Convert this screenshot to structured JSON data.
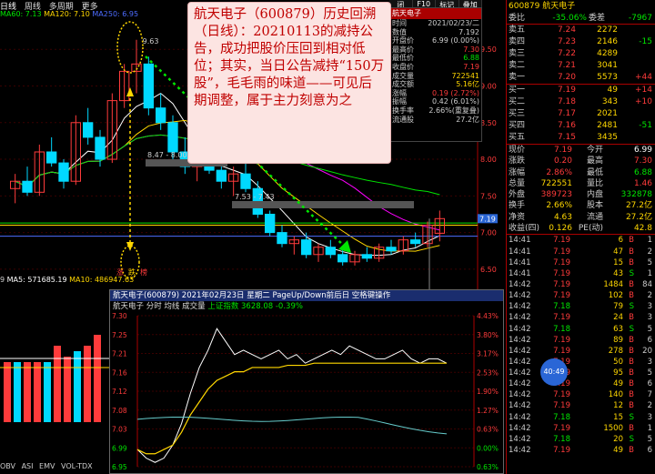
{
  "tabs": [
    "日线",
    "周线",
    "多周期",
    "更多"
  ],
  "ma_top": [
    {
      "label": "MA60: 7.13",
      "color": "#00e600"
    },
    {
      "label": "MA120: 7.10",
      "color": "#ffd700"
    },
    {
      "label": "MA250: 6.95",
      "color": "#4d6cff"
    }
  ],
  "annotation": "航天电子（600879）历史回溯（日线）：20210113的减持公告，成功把股价压回到相对低位；其实，当日公告减持“150万股”，毛毛雨的味道——可见后期调整，属于主力刻意为之",
  "fkeys": [
    "闭",
    "F10",
    "标记",
    "叠加"
  ],
  "info_window": {
    "title": "航天电子",
    "rows": [
      {
        "k": "时间",
        "v": "2021/02/23/二",
        "c": "#ccc"
      },
      {
        "k": "数值",
        "v": "7.192",
        "c": "#ccc"
      },
      {
        "k": "开盘价",
        "v": "6.99 (0.00%)",
        "c": "#ccc"
      },
      {
        "k": "最高价",
        "v": "7.30",
        "c": "#ff3b3b"
      },
      {
        "k": "最低价",
        "v": "6.88",
        "c": "#00e600"
      },
      {
        "k": "收盘价",
        "v": "7.19",
        "c": "#ff3b3b"
      },
      {
        "k": "成交量",
        "v": "722541",
        "c": "#ffd700"
      },
      {
        "k": "成交额",
        "v": "5.16亿",
        "c": "#ffd700"
      },
      {
        "k": "涨幅",
        "v": "0.19 (2.72%)",
        "c": "#ff3b3b"
      },
      {
        "k": "振幅",
        "v": "0.42 (6.01%)",
        "c": "#ccc"
      },
      {
        "k": "换手率",
        "v": "2.66%(重复叠)",
        "c": "#ccc"
      },
      {
        "k": "流通股",
        "v": "27.2亿",
        "c": "#ccc"
      }
    ]
  },
  "chart_labels": {
    "peak": "9.63",
    "box1": "8.47 - 8.00",
    "box2": "7.53 - 7.43",
    "price_marker": "7.19",
    "dots_text": [
      "涨",
      "跌",
      "榜"
    ]
  },
  "chart_data": {
    "type": "candlestick",
    "y_ticks": [
      "9.50",
      "9.00",
      "8.50",
      "8.00",
      "7.50",
      "7.00",
      "6.50"
    ],
    "ylim": [
      6.3,
      9.9
    ],
    "candles": [
      [
        7.6,
        7.8,
        7.4,
        7.7
      ],
      [
        7.7,
        7.9,
        7.5,
        7.55
      ],
      [
        7.55,
        8.2,
        7.5,
        8.1
      ],
      [
        8.1,
        8.3,
        7.9,
        7.95
      ],
      [
        7.95,
        8.0,
        7.6,
        7.7
      ],
      [
        7.7,
        8.6,
        7.65,
        8.5
      ],
      [
        8.5,
        8.7,
        8.2,
        8.3
      ],
      [
        8.3,
        8.4,
        7.9,
        8.0
      ],
      [
        8.0,
        8.9,
        7.95,
        8.8
      ],
      [
        8.8,
        9.3,
        8.7,
        9.2
      ],
      [
        9.2,
        9.63,
        8.9,
        9.3
      ],
      [
        9.3,
        9.4,
        8.6,
        8.7
      ],
      [
        8.7,
        8.9,
        8.4,
        8.5
      ],
      [
        8.5,
        8.6,
        8.0,
        8.1
      ],
      [
        8.1,
        8.3,
        7.8,
        7.9
      ],
      [
        7.9,
        8.1,
        7.7,
        8.0
      ],
      [
        8.0,
        8.2,
        7.8,
        7.85
      ],
      [
        7.85,
        8.0,
        7.6,
        7.7
      ],
      [
        7.7,
        7.9,
        7.5,
        7.8
      ],
      [
        7.8,
        7.95,
        7.55,
        7.6
      ],
      [
        7.6,
        7.7,
        7.2,
        7.25
      ],
      [
        7.25,
        7.3,
        6.95,
        7.0
      ],
      [
        7.0,
        7.1,
        6.8,
        6.85
      ],
      [
        6.85,
        6.95,
        6.7,
        6.9
      ],
      [
        6.9,
        7.0,
        6.65,
        6.7
      ],
      [
        6.7,
        6.85,
        6.6,
        6.8
      ],
      [
        6.8,
        6.9,
        6.65,
        6.7
      ],
      [
        6.7,
        6.8,
        6.55,
        6.6
      ],
      [
        6.6,
        6.75,
        6.55,
        6.7
      ],
      [
        6.7,
        6.8,
        6.6,
        6.65
      ],
      [
        6.65,
        6.85,
        6.6,
        6.8
      ],
      [
        6.8,
        6.9,
        6.7,
        6.75
      ],
      [
        6.75,
        6.95,
        6.7,
        6.9
      ],
      [
        6.9,
        7.0,
        6.8,
        6.85
      ],
      [
        6.85,
        7.15,
        6.8,
        7.1
      ],
      [
        6.99,
        7.3,
        6.88,
        7.19
      ]
    ]
  },
  "vol_ma": [
    {
      "label": "MA5: 571685.19",
      "color": "#fff"
    },
    {
      "label": "MA10: 486947.63",
      "color": "#ffd700"
    }
  ],
  "vol_data": [
    0.55,
    0.55,
    0.55,
    0.55,
    0.55,
    0.7,
    0.6,
    0.65,
    0.7,
    0.8
  ],
  "bottom_tabs": [
    "OBV",
    "ASI",
    "EMV",
    "VOL-TDX"
  ],
  "popup": {
    "title": "航天电子(600879) 2021年02月23日 星期二 PageUp/Down前后日 空格键操作",
    "sub": "航天电子  分时  均线  成交量",
    "index": "上证指数 3628.08 -0.39%",
    "y_left": [
      "7.30",
      "7.25",
      "7.21",
      "7.16",
      "7.12",
      "7.08",
      "7.03",
      "6.99",
      "6.95"
    ],
    "y_right": [
      "4.43%",
      "3.80%",
      "3.17%",
      "2.53%",
      "1.90%",
      "1.27%",
      "0.63%",
      "0.00%",
      "0.63%"
    ],
    "price_line": [
      6.99,
      6.97,
      6.96,
      6.97,
      7.0,
      7.05,
      7.12,
      7.18,
      7.22,
      7.27,
      7.24,
      7.21,
      7.22,
      7.21,
      7.2,
      7.21,
      7.22,
      7.2,
      7.21,
      7.19,
      7.2,
      7.21,
      7.22,
      7.21,
      7.23,
      7.22,
      7.21,
      7.2,
      7.2,
      7.21,
      7.22,
      7.2,
      7.19,
      7.2,
      7.2,
      7.19
    ],
    "avg_line": [
      6.99,
      6.98,
      6.98,
      6.99,
      7.0,
      7.03,
      7.07,
      7.1,
      7.13,
      7.15,
      7.16,
      7.17,
      7.17,
      7.18,
      7.18,
      7.18,
      7.18,
      7.185,
      7.185,
      7.185,
      7.19,
      7.19,
      7.19,
      7.19,
      7.19,
      7.19,
      7.19,
      7.19,
      7.19,
      7.19,
      7.19,
      7.19,
      7.19,
      7.19,
      7.19,
      7.19
    ]
  },
  "right": {
    "title": "600879 航天电子",
    "weibi": {
      "k": "委比",
      "v": "-35.06%",
      "k2": "委差",
      "v2": "-7967"
    },
    "asks": [
      {
        "k": "卖五",
        "p": "7.24",
        "v": "2272",
        "c": ""
      },
      {
        "k": "卖四",
        "p": "7.23",
        "v": "2146",
        "c": "-15"
      },
      {
        "k": "卖三",
        "p": "7.22",
        "v": "4289",
        "c": ""
      },
      {
        "k": "卖二",
        "p": "7.21",
        "v": "3041",
        "c": ""
      },
      {
        "k": "卖一",
        "p": "7.20",
        "v": "5573",
        "c": "+44"
      }
    ],
    "bids": [
      {
        "k": "买一",
        "p": "7.19",
        "v": "49",
        "c": "+14"
      },
      {
        "k": "买二",
        "p": "7.18",
        "v": "343",
        "c": "+10"
      },
      {
        "k": "买三",
        "p": "7.17",
        "v": "2021",
        "c": ""
      },
      {
        "k": "买四",
        "p": "7.16",
        "v": "2481",
        "c": "-51"
      },
      {
        "k": "买五",
        "p": "7.15",
        "v": "3435",
        "c": ""
      }
    ],
    "stats": [
      {
        "k": "现价",
        "v": "7.19",
        "vc": "#ff3b3b",
        "k2": "今开",
        "v2": "6.99",
        "v2c": "#fff"
      },
      {
        "k": "涨跌",
        "v": "0.20",
        "vc": "#ff3b3b",
        "k2": "最高",
        "v2": "7.30",
        "v2c": "#ff3b3b"
      },
      {
        "k": "涨幅",
        "v": "2.86%",
        "vc": "#ff3b3b",
        "k2": "最低",
        "v2": "6.88",
        "v2c": "#00e600"
      },
      {
        "k": "总量",
        "v": "722551",
        "vc": "#ffd700",
        "k2": "量比",
        "v2": "1.46",
        "v2c": "#ff3b3b"
      },
      {
        "k": "外盘",
        "v": "389723",
        "vc": "#ff3b3b",
        "k2": "内盘",
        "v2": "332878",
        "v2c": "#00e600"
      },
      {
        "k": "换手",
        "v": "2.66%",
        "vc": "#ffd700",
        "k2": "股本",
        "v2": "27.2亿",
        "v2c": "#ffd700"
      },
      {
        "k": "净资",
        "v": "4.63",
        "vc": "#ffd700",
        "k2": "流通",
        "v2": "27.2亿",
        "v2c": "#ffd700"
      },
      {
        "k": "收益(四)",
        "v": "0.126",
        "vc": "#ffd700",
        "k2": "PE(动)",
        "v2": "42.8",
        "v2c": "#ffd700"
      }
    ],
    "ticks": [
      {
        "t": "14:41",
        "p": "7.19",
        "v": "6",
        "bs": "B",
        "n": "1"
      },
      {
        "t": "14:41",
        "p": "7.19",
        "v": "47",
        "bs": "B",
        "n": "2"
      },
      {
        "t": "14:41",
        "p": "7.19",
        "v": "15",
        "bs": "B",
        "n": "5"
      },
      {
        "t": "14:41",
        "p": "7.19",
        "v": "43",
        "bs": "S",
        "n": "1"
      },
      {
        "t": "14:42",
        "p": "7.19",
        "v": "1484",
        "bs": "B",
        "n": "84"
      },
      {
        "t": "14:42",
        "p": "7.19",
        "v": "102",
        "bs": "B",
        "n": "2"
      },
      {
        "t": "14:42",
        "p": "7.18",
        "v": "79",
        "bs": "S",
        "n": "3"
      },
      {
        "t": "14:42",
        "p": "7.19",
        "v": "24",
        "bs": "B",
        "n": "3"
      },
      {
        "t": "14:42",
        "p": "7.18",
        "v": "63",
        "bs": "S",
        "n": "5"
      },
      {
        "t": "14:42",
        "p": "7.19",
        "v": "89",
        "bs": "B",
        "n": "6"
      },
      {
        "t": "14:42",
        "p": "7.19",
        "v": "278",
        "bs": "B",
        "n": "20"
      },
      {
        "t": "14:42",
        "p": "7.19",
        "v": "50",
        "bs": "B",
        "n": "3"
      },
      {
        "t": "14:42",
        "p": "7.19",
        "v": "95",
        "bs": "B",
        "n": "5"
      },
      {
        "t": "14:42",
        "p": "7.19",
        "v": "49",
        "bs": "B",
        "n": "6"
      },
      {
        "t": "14:42",
        "p": "7.19",
        "v": "140",
        "bs": "B",
        "n": "7"
      },
      {
        "t": "14:42",
        "p": "7.19",
        "v": "12",
        "bs": "B",
        "n": "2"
      },
      {
        "t": "14:42",
        "p": "7.18",
        "v": "15",
        "bs": "S",
        "n": "3"
      },
      {
        "t": "14:42",
        "p": "7.19",
        "v": "1500",
        "bs": "B",
        "n": "1"
      },
      {
        "t": "14:42",
        "p": "7.18",
        "v": "20",
        "bs": "S",
        "n": "5"
      },
      {
        "t": "14:42",
        "p": "7.19",
        "v": "49",
        "bs": "B",
        "n": "6"
      }
    ],
    "clock": "40:49"
  }
}
